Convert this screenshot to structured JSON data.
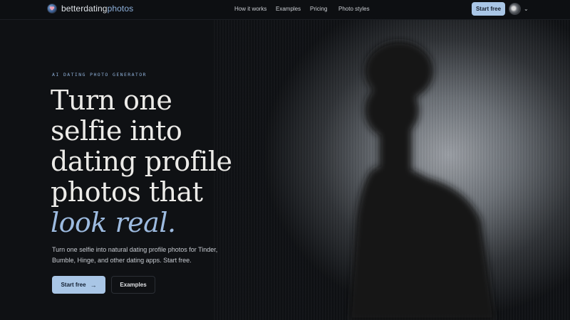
{
  "nav": {
    "brand_prefix": "betterdating",
    "brand_suffix": "photos",
    "links": [
      "How it works",
      "Examples",
      "Pricing",
      "Photo styles"
    ],
    "cta": "Start free",
    "avatar_chevron": "⌄"
  },
  "hero": {
    "eyebrow": "AI DATING PHOTO GENERATOR",
    "headline_lines": [
      "Turn one",
      "selfie into",
      "dating profile",
      "photos that"
    ],
    "headline_accent": "look real.",
    "subtext": "Turn one selfie into natural dating profile photos for Tinder, Bumble, Hinge, and other dating apps. Start free.",
    "primary_button": "Start free",
    "secondary_button": "Examples",
    "arrow": "→"
  },
  "colors": {
    "accent": "#a9c6e6",
    "background": "#0f1114",
    "headline_accent": "#9dbbe0"
  }
}
